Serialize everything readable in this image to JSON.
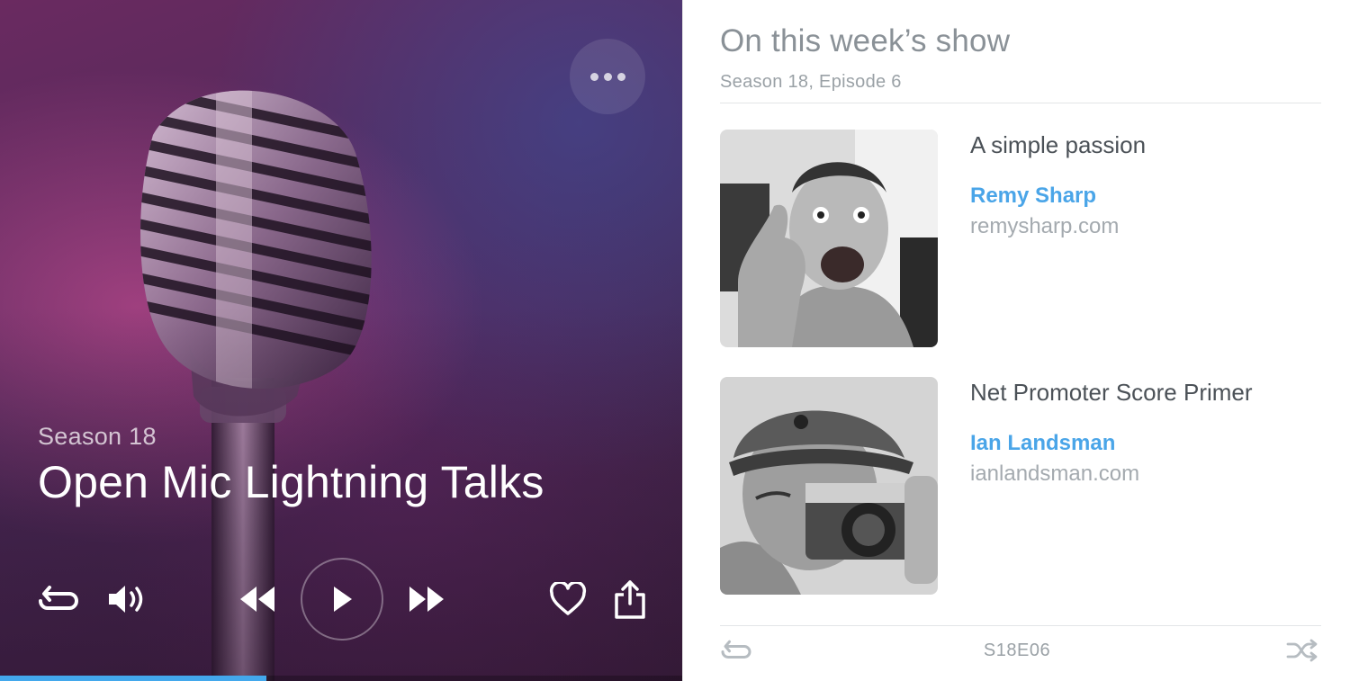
{
  "player": {
    "season_label": "Season 18",
    "episode_title": "Open Mic Lightning Talks",
    "progress_fraction": 0.39,
    "controls": {
      "repeat": "repeat-icon",
      "volume": "volume-icon",
      "rewind": "rewind-icon",
      "play": "play-icon",
      "fast_forward": "fast-forward-icon",
      "like": "heart-icon",
      "share": "share-icon",
      "more": "more-options-icon"
    }
  },
  "panel": {
    "title": "On this week’s show",
    "subtitle": "Season 18, Episode 6",
    "talks": [
      {
        "title": "A simple passion",
        "speaker": "Remy Sharp",
        "site": "remysharp.com"
      },
      {
        "title": "Net Promoter Score Primer",
        "speaker": "Ian Landsman",
        "site": "ianlandsman.com"
      }
    ],
    "footer": {
      "code": "S18E06",
      "left_icon": "repeat-icon",
      "right_icon": "shuffle-icon"
    }
  },
  "colors": {
    "accent": "#4aa5e8",
    "progress": "#43a8ec",
    "player_bg": "#4b2a5a"
  }
}
